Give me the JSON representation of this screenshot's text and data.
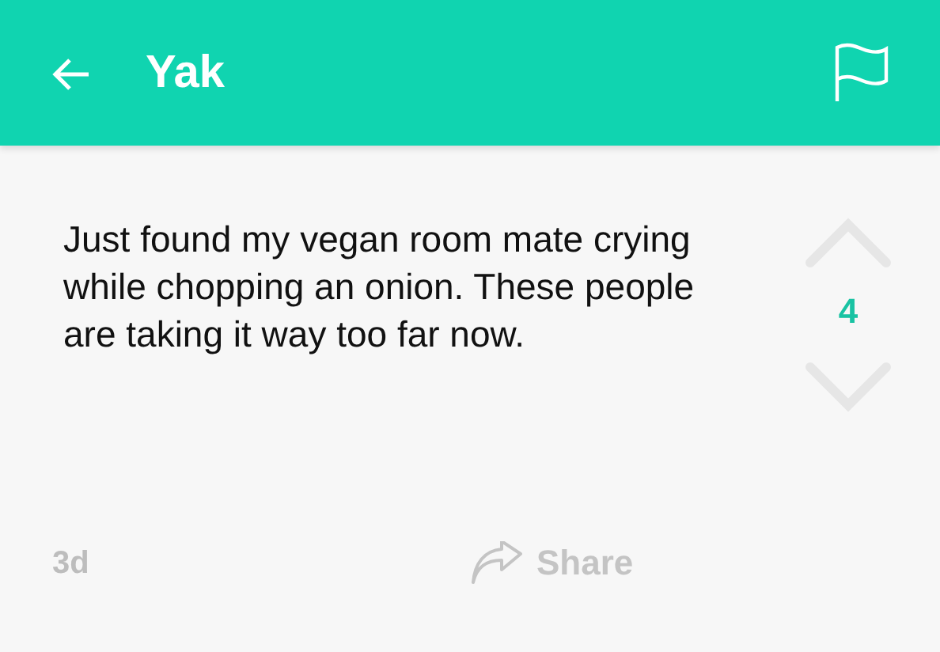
{
  "app_bar": {
    "title": "Yak"
  },
  "post": {
    "text": "Just found my vegan room mate crying while chopping an onion. These people are taking it way too far now.",
    "score": "4"
  },
  "footer": {
    "age": "3d",
    "share_label": "Share"
  }
}
